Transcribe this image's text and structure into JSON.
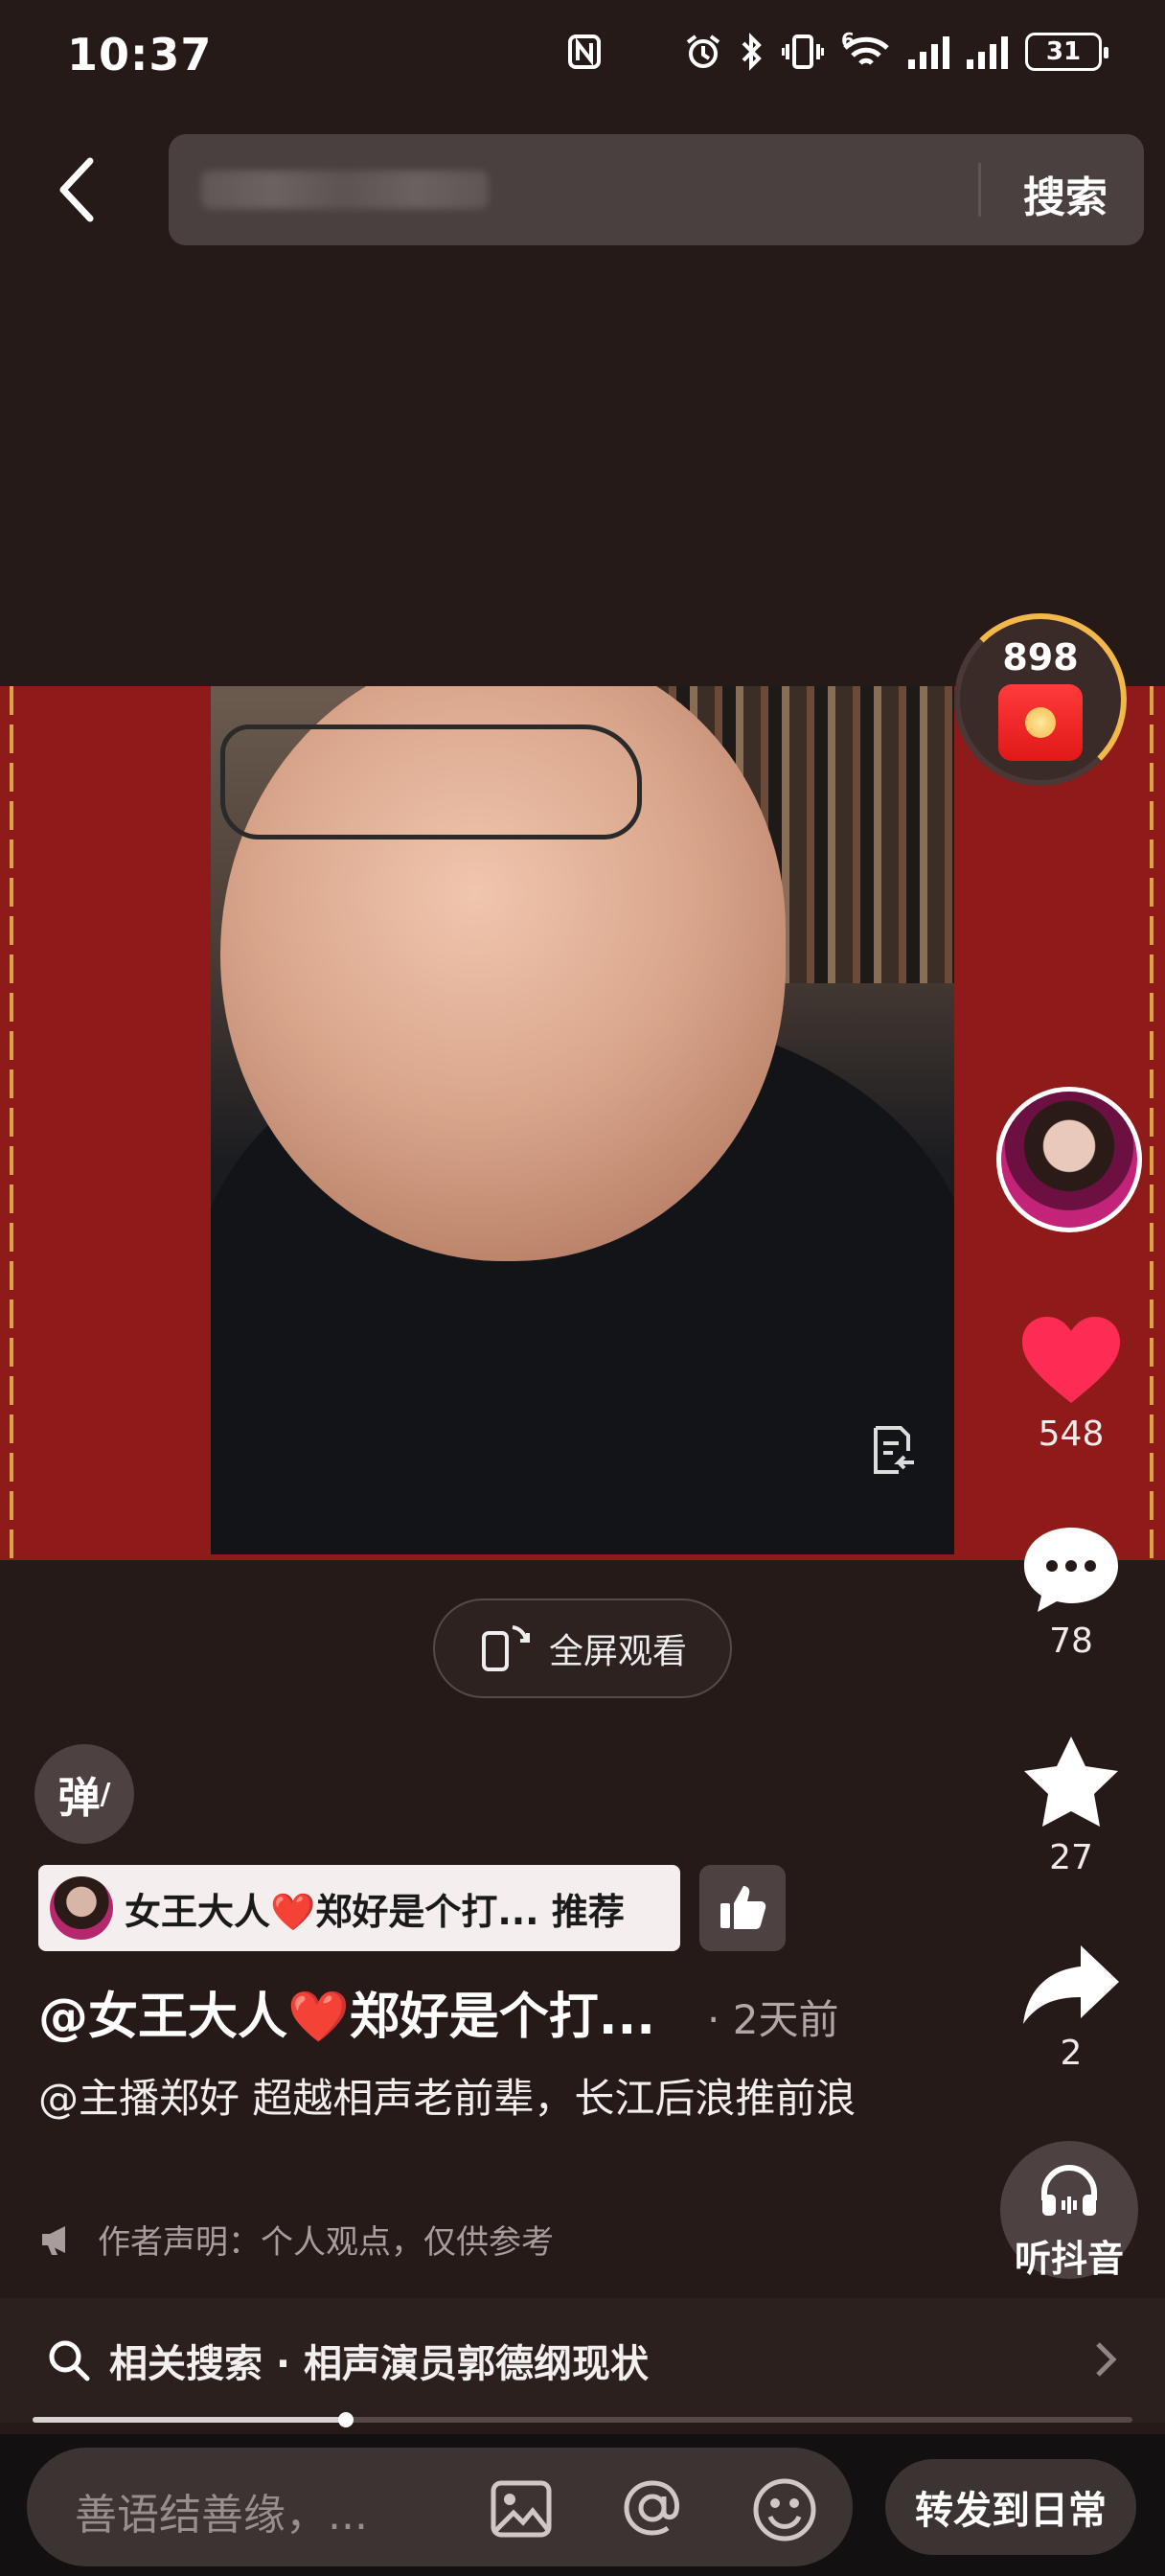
{
  "status_bar": {
    "time": "10:37",
    "network_label": "6",
    "battery": "31",
    "icons": [
      "nfc-icon",
      "alarm-icon",
      "bluetooth-icon",
      "vibrate-icon",
      "wifi-icon",
      "signal-icon",
      "signal-icon",
      "battery-icon"
    ]
  },
  "search": {
    "button_label": "搜索"
  },
  "video": {
    "fullscreen_label": "全屏观看"
  },
  "sidebar": {
    "red_packet_count": "898",
    "likes": "548",
    "comments": "78",
    "favorites": "27",
    "shares": "2",
    "listen_label": "听抖音"
  },
  "post": {
    "danmaku_label": "弹",
    "recommend_tag": "女王大人❤️郑好是个打... 推荐",
    "author": "@女王大人❤️郑好是个打...",
    "time": "· 2天前",
    "description": "@主播郑好 超越相声老前辈，长江后浪推前浪",
    "disclaimer": "作者声明：个人观点，仅供参考"
  },
  "related": {
    "label": "相关搜索 · 相声演员郭德纲现状"
  },
  "progress": {
    "fraction": 0.285
  },
  "bottom": {
    "comment_placeholder": "善语结善缘，...",
    "forward_label": "转发到日常"
  },
  "colors": {
    "background": "#261a19",
    "video_border": "#8f1a1a",
    "like_red": "#fe2c55",
    "gold": "#f3b84a"
  }
}
